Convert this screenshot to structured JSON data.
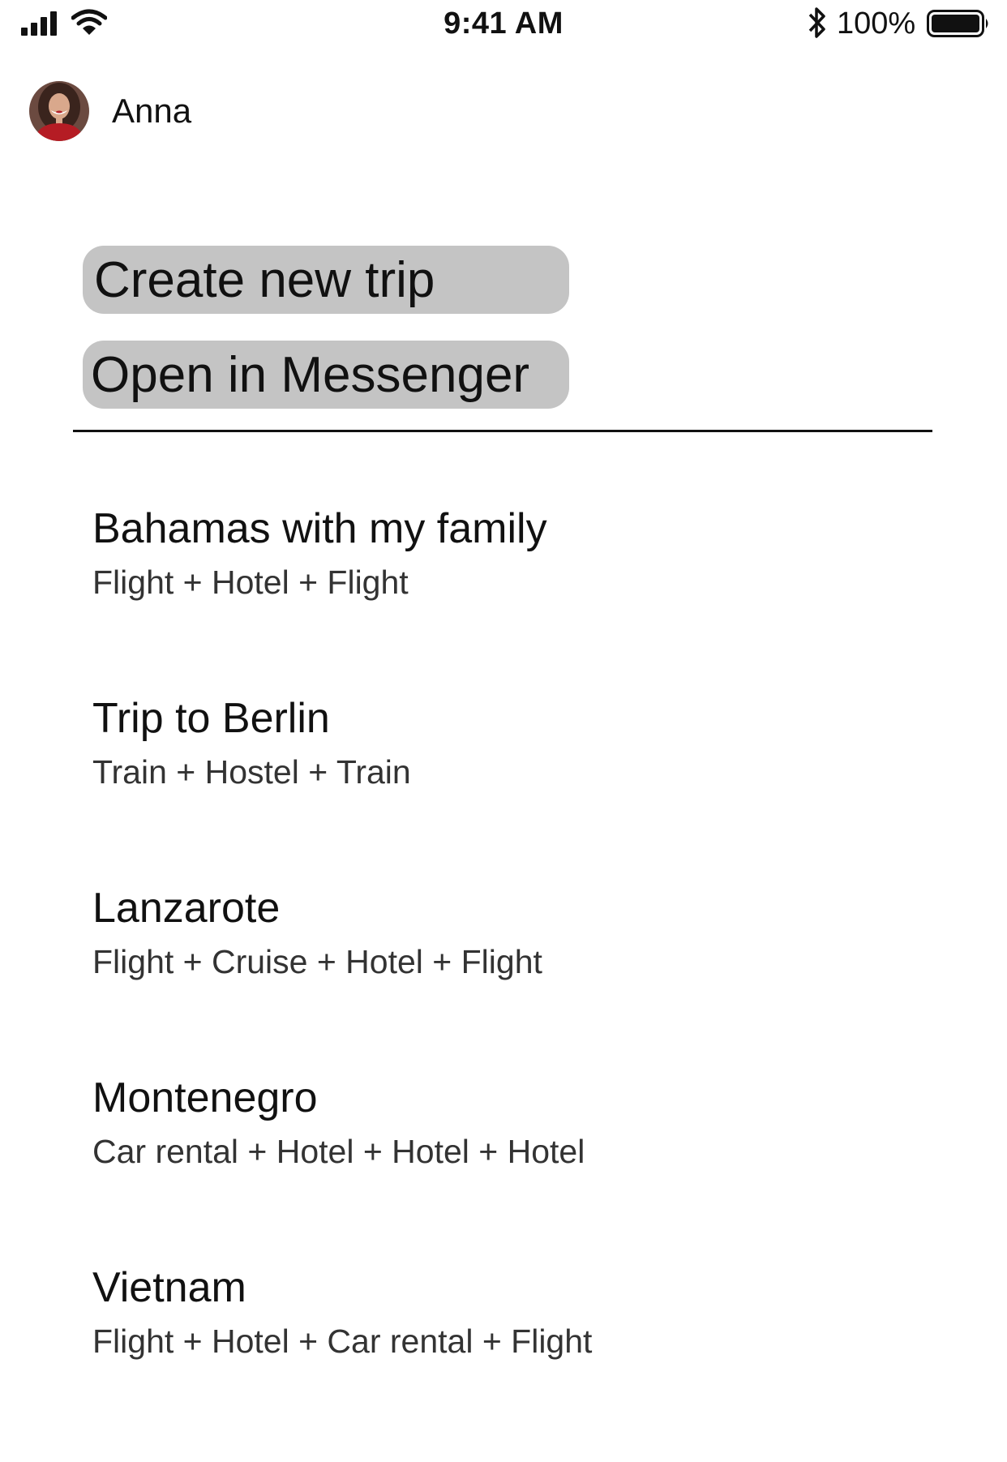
{
  "status_bar": {
    "time": "9:41 AM",
    "battery_percent": "100%",
    "battery_level": 1.0,
    "icons": [
      "signal-icon",
      "wifi-icon",
      "bluetooth-icon",
      "battery-icon"
    ]
  },
  "profile": {
    "name": "Anna"
  },
  "actions": {
    "create_trip": "Create new trip",
    "open_messenger": "Open in Messenger",
    "button_color": "#c4c4c4"
  },
  "trips": [
    {
      "title": "Bahamas with my family",
      "detail": "Flight + Hotel + Flight"
    },
    {
      "title": "Trip to Berlin",
      "detail": "Train + Hostel + Train"
    },
    {
      "title": "Lanzarote",
      "detail": "Flight + Cruise + Hotel + Flight"
    },
    {
      "title": "Montenegro",
      "detail": "Car rental + Hotel + Hotel + Hotel"
    },
    {
      "title": "Vietnam",
      "detail": "Flight + Hotel + Car rental + Flight"
    }
  ]
}
